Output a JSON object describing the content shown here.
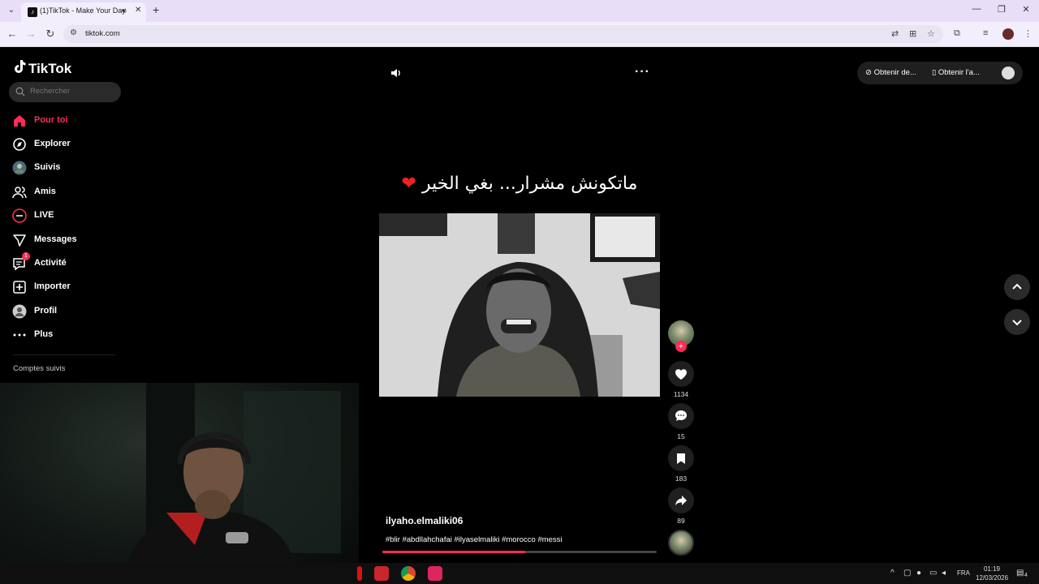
{
  "browser": {
    "tab_title": "(1)TikTok - Make Your Day",
    "url": "tiktok.com"
  },
  "tiktok": {
    "brand": "TikTok",
    "search_placeholder": "Rechercher",
    "nav": [
      {
        "label": "Pour toi",
        "icon": "home-icon",
        "active": true
      },
      {
        "label": "Explorer",
        "icon": "compass-icon"
      },
      {
        "label": "Suivis",
        "icon": "avatar-icon"
      },
      {
        "label": "Amis",
        "icon": "friends-icon"
      },
      {
        "label": "LIVE",
        "icon": "live-icon"
      },
      {
        "label": "Messages",
        "icon": "send-icon"
      },
      {
        "label": "Activité",
        "icon": "inbox-icon",
        "badge": "1"
      },
      {
        "label": "Importer",
        "icon": "plus-square-icon"
      },
      {
        "label": "Profil",
        "icon": "avatar-icon"
      },
      {
        "label": "Plus",
        "icon": "more-icon"
      }
    ],
    "following_heading": "Comptes suivis",
    "top_actions": {
      "get_coins": "Obtenir de...",
      "get_app": "Obtenir l'a..."
    }
  },
  "video": {
    "caption_overlay": "ماتكونش مشرار... بغي الخير",
    "username": "ilyaho.elmaliki06",
    "hashtags": "#blir #abdllahchafai #ilyaselmaliki #morocco #messi",
    "progress": 0.52,
    "likes": "1134",
    "comments": "15",
    "saves": "183",
    "shares": "89"
  },
  "taskbar": {
    "lang": "FRA",
    "time": "01:19",
    "date": "12/03/2026",
    "notifications": "4"
  },
  "colors": {
    "accent": "#fe2c55",
    "background": "#000000",
    "chrome_frame": "#e8def8"
  }
}
